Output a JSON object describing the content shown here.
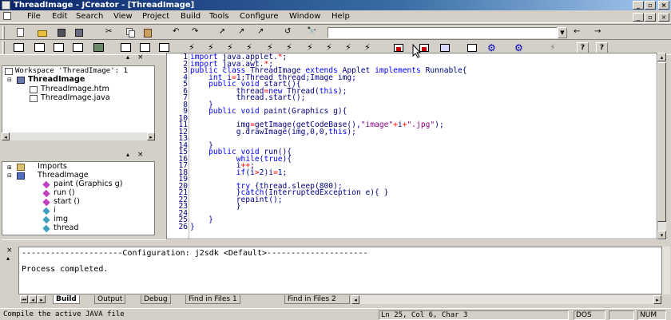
{
  "window": {
    "title": "ThreadImage - JCreator - [ThreadImage]"
  },
  "menu": [
    "File",
    "Edit",
    "Search",
    "View",
    "Project",
    "Build",
    "Tools",
    "Configure",
    "Window",
    "Help"
  ],
  "workspace": {
    "header": "Workspace 'ThreadImage': 1",
    "project": "ThreadImage",
    "files": [
      "ThreadImage.htm",
      "ThreadImage.java"
    ]
  },
  "classview": {
    "items": [
      "Imports",
      "ThreadImage",
      "paint (Graphics g)",
      "run ()",
      "start ()",
      "i",
      "img",
      "thread"
    ]
  },
  "code": {
    "lines": [
      [
        [
          "kw",
          "import"
        ],
        [
          "tx",
          " java.applet."
        ],
        [
          "op",
          "*"
        ],
        [
          "tx",
          ";"
        ]
      ],
      [
        [
          "kw",
          "import"
        ],
        [
          "tx",
          " java.awt."
        ],
        [
          "op",
          "*"
        ],
        [
          "tx",
          ";"
        ]
      ],
      [
        [
          "kw",
          "public class"
        ],
        [
          "tx",
          " ThreadImage "
        ],
        [
          "kw",
          "extends"
        ],
        [
          "tx",
          " Applet "
        ],
        [
          "kw",
          "implements"
        ],
        [
          "tx",
          " Runnable{"
        ]
      ],
      [
        [
          "tx",
          "    "
        ],
        [
          "kw",
          "int"
        ],
        [
          "tx",
          " i"
        ],
        [
          "op",
          "="
        ],
        [
          "tx",
          "1;Thread thread;Image img;"
        ]
      ],
      [
        [
          "tx",
          "    "
        ],
        [
          "kw",
          "public void"
        ],
        [
          "tx",
          " start(){"
        ]
      ],
      [
        [
          "tx",
          "          thread"
        ],
        [
          "op",
          "="
        ],
        [
          "kw",
          "new"
        ],
        [
          "tx",
          " Thread("
        ],
        [
          "kw",
          "this"
        ],
        [
          "tx",
          ");"
        ]
      ],
      [
        [
          "tx",
          "          thread.start();"
        ]
      ],
      [
        [
          "tx",
          "    }"
        ]
      ],
      [
        [
          "tx",
          "    "
        ],
        [
          "kw",
          "public void"
        ],
        [
          "tx",
          " paint(Graphics g){"
        ]
      ],
      [
        [
          "tx",
          ""
        ]
      ],
      [
        [
          "tx",
          "          img"
        ],
        [
          "op",
          "="
        ],
        [
          "tx",
          "getImage(getCodeBase(),"
        ],
        [
          "st",
          "\"image\""
        ],
        [
          "op",
          "+"
        ],
        [
          "tx",
          "i"
        ],
        [
          "op",
          "+"
        ],
        [
          "st",
          "\".jpg\""
        ],
        [
          "tx",
          ");"
        ]
      ],
      [
        [
          "tx",
          "          g.drawImage(img,0,0,"
        ],
        [
          "kw",
          "this"
        ],
        [
          "tx",
          ");"
        ]
      ],
      [
        [
          "tx",
          ""
        ]
      ],
      [
        [
          "tx",
          "    }"
        ]
      ],
      [
        [
          "tx",
          "    "
        ],
        [
          "kw",
          "public void"
        ],
        [
          "tx",
          " run(){"
        ]
      ],
      [
        [
          "tx",
          "          "
        ],
        [
          "kw",
          "while"
        ],
        [
          "tx",
          "("
        ],
        [
          "kw",
          "true"
        ],
        [
          "tx",
          "){"
        ]
      ],
      [
        [
          "tx",
          "          i"
        ],
        [
          "op",
          "++"
        ],
        [
          "tx",
          ";"
        ]
      ],
      [
        [
          "tx",
          "          "
        ],
        [
          "kw",
          "if"
        ],
        [
          "tx",
          "(i"
        ],
        [
          "op",
          ">"
        ],
        [
          "tx",
          "2)i"
        ],
        [
          "op",
          "="
        ],
        [
          "tx",
          "1;"
        ]
      ],
      [
        [
          "tx",
          ""
        ]
      ],
      [
        [
          "tx",
          "          "
        ],
        [
          "kw",
          "try"
        ],
        [
          "tx",
          " {thread.sleep(800);"
        ]
      ],
      [
        [
          "tx",
          "          }"
        ],
        [
          "kw",
          "catch"
        ],
        [
          "tx",
          "(InterruptedException e){ }"
        ]
      ],
      [
        [
          "tx",
          "          repaint();"
        ]
      ],
      [
        [
          "tx",
          "          }"
        ]
      ],
      [
        [
          "tx",
          ""
        ]
      ],
      [
        [
          "tx",
          "    }"
        ]
      ],
      [
        [
          "tx",
          "}"
        ]
      ]
    ]
  },
  "output": {
    "config_line": "---------------------Configuration: j2sdk <Default>---------------------",
    "result": "Process completed.",
    "tabs": [
      "Build",
      "Output",
      "Debug",
      "Find in Files 1",
      "Find in Files 2"
    ]
  },
  "status": {
    "message": "Compile the active JAVA file",
    "position": "Ln 25, Col 6, Char 3",
    "dos": "DOS",
    "num": "NUM"
  },
  "colors": {
    "keyword": "#0000ff",
    "string": "#8b008b",
    "operator": "#ff0000",
    "text": "#000080",
    "linenum": "#000080"
  }
}
